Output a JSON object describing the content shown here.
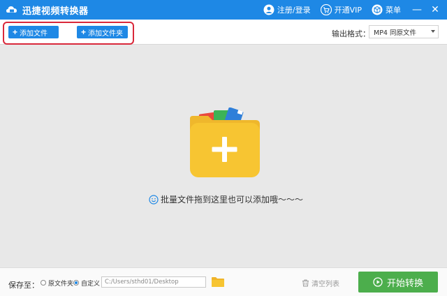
{
  "app": {
    "title": "迅捷视频转换器"
  },
  "titlebar": {
    "register_login": "注册/登录",
    "open_vip": "开通VIP",
    "menu": "菜单",
    "minimize": "—",
    "close": "✕"
  },
  "toolbar": {
    "add_file": "添加文件",
    "add_folder": "添加文件夹",
    "output_format_label": "输出格式：",
    "output_format_value": "MP4  同原文件"
  },
  "drop_area": {
    "hint": "批量文件拖到这里也可以添加哦～～～"
  },
  "bottom": {
    "save_to_label": "保存至：",
    "option_original": "原文件夹",
    "option_custom": "自定义",
    "selected_option": "custom",
    "path_value": "C:/Users/sthd01/Desktop",
    "clear_list": "清空列表",
    "start_convert": "开始转换"
  },
  "colors": {
    "brand_blue": "#1e88e5",
    "start_green": "#4cae4c",
    "highlight_red": "#d9283a",
    "folder_yellow": "#f7c532"
  }
}
